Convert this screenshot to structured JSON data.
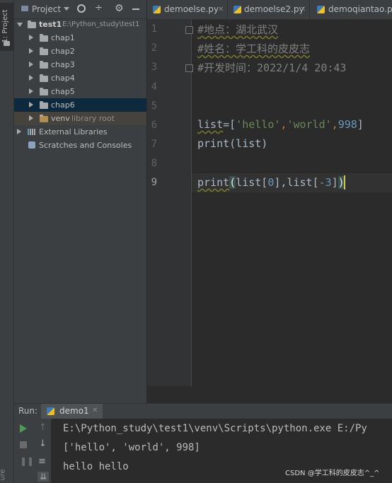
{
  "tool_strip": {
    "project_tab": "1: Project",
    "bottom_label": "ure"
  },
  "project_panel": {
    "title": "Project",
    "root": {
      "name": "test1",
      "path": "E:\\Python_study\\test1"
    },
    "folders": [
      "chap1",
      "chap2",
      "chap3",
      "chap4",
      "chap5",
      "chap6"
    ],
    "selected_folder": "chap6",
    "venv": {
      "name": "venv",
      "note": "library root"
    },
    "external_libraries": "External Libraries",
    "scratches": "Scratches and Consoles"
  },
  "editor_tabs": [
    {
      "label": "demoelse.py"
    },
    {
      "label": "demoelse2.py"
    },
    {
      "label": "demoqiantao.py"
    }
  ],
  "editor": {
    "line_numbers": [
      "1",
      "2",
      "3",
      "4",
      "5",
      "6",
      "7",
      "8",
      "9"
    ],
    "lines": {
      "l1": "#地点：湖北武汉",
      "l2": "#姓名：学工科的皮皮志",
      "l3": "#开发时间：2022/1/4  20:43",
      "l6_name": "list",
      "l6_eq": "=[",
      "l6_s1": "'hello'",
      "l6_c1": ",",
      "l6_s2": "'world'",
      "l6_c2": ",",
      "l6_n": "998",
      "l6_end": "]",
      "l7": "print(list)",
      "l9_fn": "print",
      "l9_open": "(",
      "l9_a": "list[",
      "l9_n0": "0",
      "l9_b": "],",
      "l9_c": "list[",
      "l9_n1": "-3",
      "l9_d": "]",
      "l9_close": ")"
    },
    "current_line": "9"
  },
  "run_panel": {
    "label": "Run:",
    "config": "demo1",
    "console": [
      "E:\\Python_study\\test1\\venv\\Scripts\\python.exe E:/Py",
      "['hello', 'world', 998]",
      "hello hello"
    ]
  },
  "watermark": "CSDN @学工科的皮皮志^_^",
  "colors": {
    "background": "#2b2b2b",
    "selection": "#0d293e",
    "comment": "#808080",
    "string": "#6a8759",
    "number": "#6897bb",
    "run_green": "#499c54"
  }
}
